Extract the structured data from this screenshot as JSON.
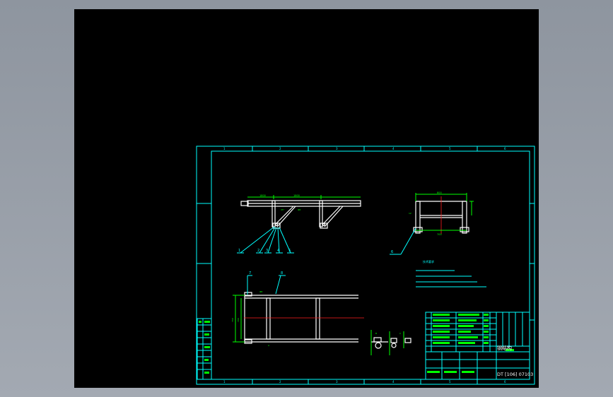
{
  "viewer": {
    "name": "CAD drawing viewer"
  },
  "drawing": {
    "border_zone_numbers_top": [
      "1",
      "2",
      "3",
      "4",
      "5",
      "6"
    ],
    "border_zone_numbers_bottom": [
      "1",
      "2",
      "3",
      "4",
      "5",
      "6"
    ],
    "balloons_side_view": [
      "1",
      "2",
      "3",
      "4",
      "5"
    ],
    "balloon_section_view": "6",
    "balloons_top_view": [
      "7",
      "8"
    ],
    "notes_title": "技术要求",
    "title_block": {
      "name": "钢结构",
      "drawing_number": "DT [106] 07103"
    }
  },
  "colors": {
    "background": "#000000",
    "frame": "#00ffff",
    "geometry": "#ffffff",
    "centerline": "#ff2020",
    "dimension": "#00ff00",
    "window_chrome": "#9aa1ab"
  }
}
